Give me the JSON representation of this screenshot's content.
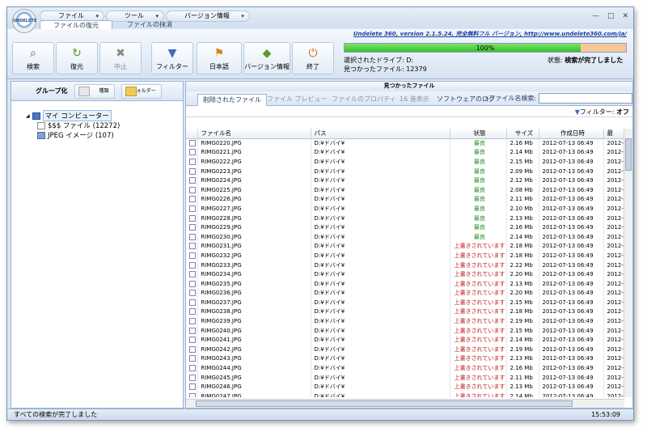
{
  "logo_text": "UNDELETE",
  "menus": [
    "ファイル",
    "ツール",
    "バージョン情報"
  ],
  "ribbon_tabs": [
    "ファイルの復元",
    "ファイルの抹消"
  ],
  "window_controls": [
    "—",
    "□",
    "✕"
  ],
  "app_link": "Undelete 360, version 2.1.5.24, 完全無料フル バージョン, http://www.undelete360.com/ja/",
  "toolbar": {
    "search": "検索",
    "restore": "復元",
    "stop": "中止",
    "filter": "フィルター",
    "language": "日本語",
    "version": "バージョン情報",
    "exit": "終了"
  },
  "progress": {
    "label": "100%",
    "value": 0.84
  },
  "drive_label": "選択されたドライブ: D:",
  "found_label": "見つかったファイル: 12379",
  "status_label": "状態:",
  "status_value": "検索が完了しました",
  "left_pane": {
    "group_label": "グループ化",
    "type_btn": "種類",
    "folder_btn": "フォルダー",
    "tree_root": "マイ コンピューター",
    "tree_items": [
      "$$$ ファイル (12272)",
      "JPEG イメージ (107)"
    ]
  },
  "right_pane": {
    "header": "見つかったファイル",
    "tabs": [
      "削除されたファイル",
      "ファイル プレビュー",
      "ファイルのプロパティ",
      "16 進表示",
      "ソフトウェアのログ"
    ],
    "search_label": "ファイル名検索:",
    "filter_label": "フィルター:",
    "filter_value": "オフ"
  },
  "table": {
    "headers": [
      "ファイル名",
      "パス",
      "状態",
      "サイズ",
      "作成日時",
      "最"
    ],
    "rows": [
      [
        "RIMG0220.JPG",
        "D:¥ドバイ¥",
        "最良",
        "2.16 Mb",
        "2012-07-13 06:49",
        "2012-"
      ],
      [
        "RIMG0221.JPG",
        "D:¥ドバイ¥",
        "最良",
        "2.14 Mb",
        "2012-07-13 06:49",
        "2012-"
      ],
      [
        "RIMG0222.JPG",
        "D:¥ドバイ¥",
        "最良",
        "2.15 Mb",
        "2012-07-13 06:49",
        "2012-"
      ],
      [
        "RIMG0223.JPG",
        "D:¥ドバイ¥",
        "最良",
        "2.09 Mb",
        "2012-07-13 06:49",
        "2012-"
      ],
      [
        "RIMG0224.JPG",
        "D:¥ドバイ¥",
        "最良",
        "2.12 Mb",
        "2012-07-13 06:49",
        "2012-"
      ],
      [
        "RIMG0225.JPG",
        "D:¥ドバイ¥",
        "最良",
        "2.08 Mb",
        "2012-07-13 06:49",
        "2012-"
      ],
      [
        "RIMG0226.JPG",
        "D:¥ドバイ¥",
        "最良",
        "2.11 Mb",
        "2012-07-13 06:49",
        "2012-"
      ],
      [
        "RIMG0227.JPG",
        "D:¥ドバイ¥",
        "最良",
        "2.10 Mb",
        "2012-07-13 06:49",
        "2012-"
      ],
      [
        "RIMG0228.JPG",
        "D:¥ドバイ¥",
        "最良",
        "2.13 Mb",
        "2012-07-13 06:49",
        "2012-"
      ],
      [
        "RIMG0229.JPG",
        "D:¥ドバイ¥",
        "最良",
        "2.16 Mb",
        "2012-07-13 06:49",
        "2012-"
      ],
      [
        "RIMG0230.JPG",
        "D:¥ドバイ¥",
        "最良",
        "2.14 Mb",
        "2012-07-13 06:49",
        "2012-"
      ],
      [
        "RIMG0231.JPG",
        "D:¥ドバイ¥",
        "上書きされています",
        "2.18 Mb",
        "2012-07-13 06:49",
        "2012-"
      ],
      [
        "RIMG0232.JPG",
        "D:¥ドバイ¥",
        "上書きされています",
        "2.18 Mb",
        "2012-07-13 06:49",
        "2012-"
      ],
      [
        "RIMG0233.JPG",
        "D:¥ドバイ¥",
        "上書きされています",
        "2.22 Mb",
        "2012-07-13 06:49",
        "2012-"
      ],
      [
        "RIMG0234.JPG",
        "D:¥ドバイ¥",
        "上書きされています",
        "2.20 Mb",
        "2012-07-13 06:49",
        "2012-"
      ],
      [
        "RIMG0235.JPG",
        "D:¥ドバイ¥",
        "上書きされています",
        "2.13 Mb",
        "2012-07-13 06:49",
        "2012-"
      ],
      [
        "RIMG0236.JPG",
        "D:¥ドバイ¥",
        "上書きされています",
        "2.20 Mb",
        "2012-07-13 06:49",
        "2012-"
      ],
      [
        "RIMG0237.JPG",
        "D:¥ドバイ¥",
        "上書きされています",
        "2.15 Mb",
        "2012-07-13 06:49",
        "2012-"
      ],
      [
        "RIMG0238.JPG",
        "D:¥ドバイ¥",
        "上書きされています",
        "2.18 Mb",
        "2012-07-13 06:49",
        "2012-"
      ],
      [
        "RIMG0239.JPG",
        "D:¥ドバイ¥",
        "上書きされています",
        "2.19 Mb",
        "2012-07-13 06:49",
        "2012-"
      ],
      [
        "RIMG0240.JPG",
        "D:¥ドバイ¥",
        "上書きされています",
        "2.15 Mb",
        "2012-07-13 06:49",
        "2012-"
      ],
      [
        "RIMG0241.JPG",
        "D:¥ドバイ¥",
        "上書きされています",
        "2.14 Mb",
        "2012-07-13 06:49",
        "2012-"
      ],
      [
        "RIMG0242.JPG",
        "D:¥ドバイ¥",
        "上書きされています",
        "2.19 Mb",
        "2012-07-13 06:49",
        "2012-"
      ],
      [
        "RIMG0243.JPG",
        "D:¥ドバイ¥",
        "上書きされています",
        "2.13 Mb",
        "2012-07-13 06:49",
        "2012-"
      ],
      [
        "RIMG0244.JPG",
        "D:¥ドバイ¥",
        "上書きされています",
        "2.16 Mb",
        "2012-07-13 06:49",
        "2012-"
      ],
      [
        "RIMG0245.JPG",
        "D:¥ドバイ¥",
        "上書きされています",
        "2.11 Mb",
        "2012-07-13 06:49",
        "2012-"
      ],
      [
        "RIMG0246.JPG",
        "D:¥ドバイ¥",
        "上書きされています",
        "2.13 Mb",
        "2012-07-13 06:49",
        "2012-"
      ],
      [
        "RIMG0247.JPG",
        "D:¥ドバイ¥",
        "上書きされています",
        "2.14 Mb",
        "2012-07-13 06:49",
        "2012-"
      ]
    ]
  },
  "status_bar": {
    "text": "すべての検索が完了しました",
    "time": "15:53:09"
  },
  "colors": {
    "good": "#1f8a1f",
    "overwritten": "#c01818",
    "progress": "#36c02a",
    "accent": "#1a3fa0"
  }
}
